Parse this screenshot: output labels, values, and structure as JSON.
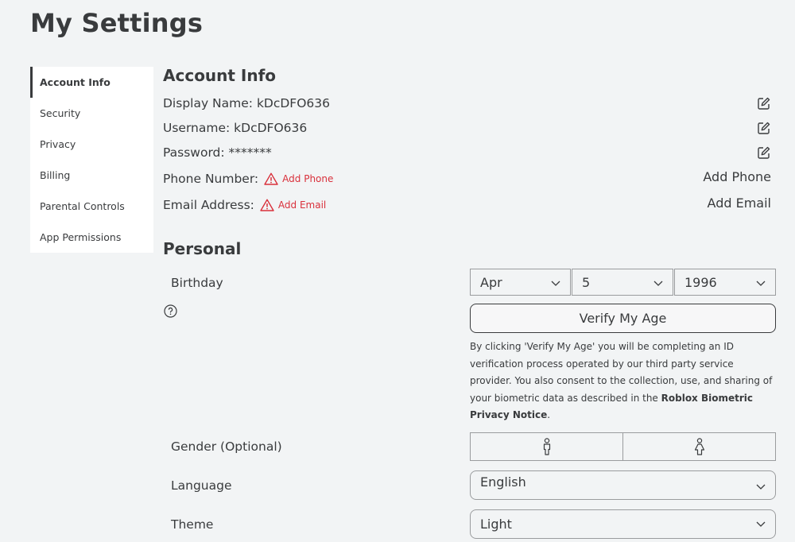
{
  "page": {
    "title": "My Settings"
  },
  "sidebar": {
    "items": [
      {
        "label": "Account Info",
        "active": true
      },
      {
        "label": "Security"
      },
      {
        "label": "Privacy"
      },
      {
        "label": "Billing"
      },
      {
        "label": "Parental Controls"
      },
      {
        "label": "App Permissions"
      }
    ]
  },
  "account": {
    "title": "Account Info",
    "display_name": "Display Name: kDcDFO636",
    "username": "Username: kDcDFO636",
    "password": "Password: *******",
    "phone_label": "Phone Number:",
    "phone_warn": "Add Phone",
    "phone_action": "Add Phone",
    "email_label": "Email Address:",
    "email_warn": "Add Email",
    "email_action": "Add Email",
    "warning_color": "#d9303b"
  },
  "personal": {
    "title": "Personal",
    "birthday_label": "Birthday",
    "birth_month": "Apr",
    "birth_day": "5",
    "birth_year": "1996",
    "verify_button": "Verify My Age",
    "disclaimer_text": "By clicking 'Verify My Age' you will be completing an ID verification process operated by our third party service provider. You also consent to the collection, use, and sharing of your biometric data as described in the ",
    "disclaimer_link": "Roblox Biometric Privacy Notice",
    "disclaimer_end": ".",
    "gender_label": "Gender (Optional)",
    "gender_options": [
      "male-icon",
      "female-icon"
    ],
    "language_label": "Language",
    "language_value": "English",
    "theme_label": "Theme",
    "theme_value": "Light"
  }
}
